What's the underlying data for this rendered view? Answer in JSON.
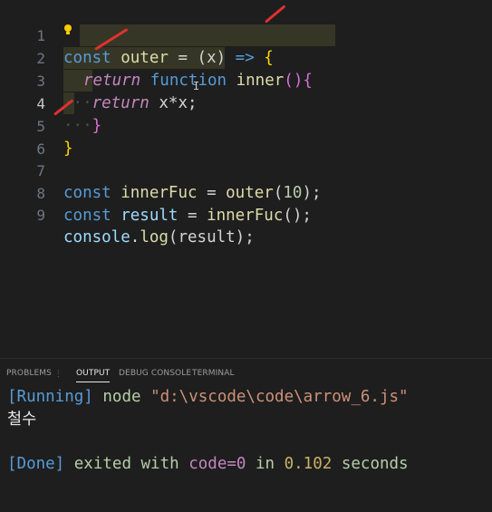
{
  "editor": {
    "line_numbers": [
      "1",
      "2",
      "3",
      "4",
      "5",
      "6",
      "7",
      "8",
      "9"
    ],
    "active_line": "4",
    "lines": {
      "l1": {
        "kw": "const",
        "name": "outer",
        "eq": " = ",
        "args": "(x)",
        "arrow": " => ",
        "brace": "{"
      },
      "l2": {
        "ret": "return",
        "func": "function",
        "name": "inner",
        "rest": "(){"
      },
      "l3": {
        "ret": "return",
        "expr": "x*x;"
      },
      "l4": {
        "brace": "}"
      },
      "l5": {
        "brace": "}"
      },
      "l7": {
        "kw": "const",
        "name": "innerFuc",
        "eq": " = ",
        "call": "outer",
        "open": "(",
        "num": "10",
        "close": ");"
      },
      "l8": {
        "kw": "const",
        "name": "result",
        "eq": " = ",
        "call": "innerFuc",
        "rest": "();"
      },
      "l9": {
        "obj": "console",
        "dot": ".",
        "method": "log",
        "rest": "(result);"
      }
    },
    "indent_dots": "···"
  },
  "panel": {
    "tabs": [
      "PROBLEMS",
      "OUTPUT",
      "DEBUG CONSOLE",
      "TERMINAL"
    ],
    "active_tab": "OUTPUT",
    "output": {
      "running_tag": "[Running]",
      "running_cmd": "node",
      "running_path": "\"d:\\vscode\\code\\arrow_6.js\"",
      "result": "철수",
      "done_tag": "[Done]",
      "done_exited": "exited with",
      "done_code": "code=0",
      "done_in": "in",
      "done_time": "0.102",
      "done_seconds": "seconds"
    }
  },
  "colors": {
    "annotation": "#e0312f",
    "keyword": "#569cd6",
    "function": "#dcdcaa"
  },
  "icons": {
    "lightbulb": "lightbulb-icon"
  }
}
